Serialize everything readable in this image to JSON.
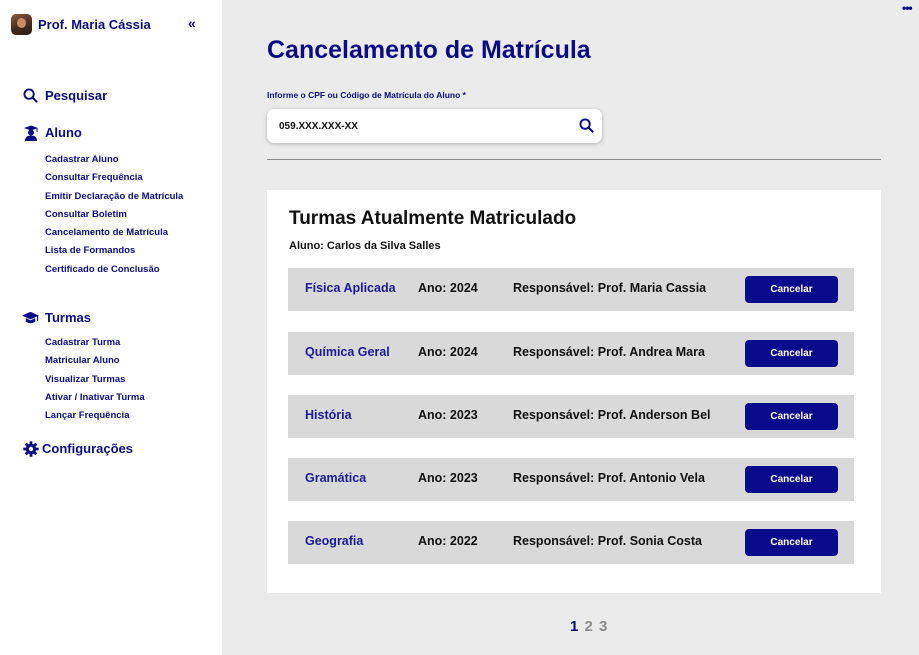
{
  "sidebar": {
    "profile_name": "Prof. Maria Cássia",
    "collapse_glyph": "«",
    "search_label": "Pesquisar",
    "aluno": {
      "label": "Aluno",
      "items": [
        "Cadastrar Aluno",
        "Consultar Frequência",
        "Emitir Declaração de Matrícula",
        "Consultar Boletim",
        "Cancelamento de Matrícula",
        "Lista de Formandos",
        "Certificado de Conclusão"
      ]
    },
    "turmas": {
      "label": "Turmas",
      "items": [
        "Cadastrar Turma",
        "Matricular Aluno",
        "Visualizar Turmas",
        "Ativar / Inativar Turma",
        "Lançar Frequência"
      ]
    },
    "config_label": "Configurações"
  },
  "main": {
    "title": "Cancelamento de Matrícula",
    "field_label": "Informe o CPF ou Código de Matrícula do Aluno *",
    "search_value": "059.XXX.XXX-XX",
    "card": {
      "title": "Turmas Atualmente Matriculado",
      "student": "Aluno: Carlos da Silva Salles",
      "rows": [
        {
          "subject": "Física Aplicada",
          "year": "Ano: 2024",
          "responsible": "Responsável: Prof. Maria Cassia",
          "button": "Cancelar"
        },
        {
          "subject": "Química Geral",
          "year": "Ano: 2024",
          "responsible": "Responsável: Prof. Andrea Mara",
          "button": "Cancelar"
        },
        {
          "subject": "História",
          "year": "Ano: 2023",
          "responsible": "Responsável: Prof. Anderson Bel",
          "button": "Cancelar"
        },
        {
          "subject": "Gramática",
          "year": "Ano: 2023",
          "responsible": "Responsável: Prof. Antonio Vela",
          "button": "Cancelar"
        },
        {
          "subject": "Geografia",
          "year": "Ano: 2022",
          "responsible": "Responsável: Prof. Sonia Costa",
          "button": "Cancelar"
        }
      ]
    },
    "pagination": [
      "1",
      "2",
      "3"
    ]
  },
  "icons": {
    "search": "search-icon",
    "student": "graduate-student-icon",
    "classes": "graduation-cap-icon",
    "settings": "gear-icon",
    "more": "more-dots-icon"
  },
  "colors": {
    "accent": "#0b0b85",
    "button": "#0a0a8c",
    "row_bg": "#d9d9d9",
    "page_bg": "#ebebeb"
  }
}
